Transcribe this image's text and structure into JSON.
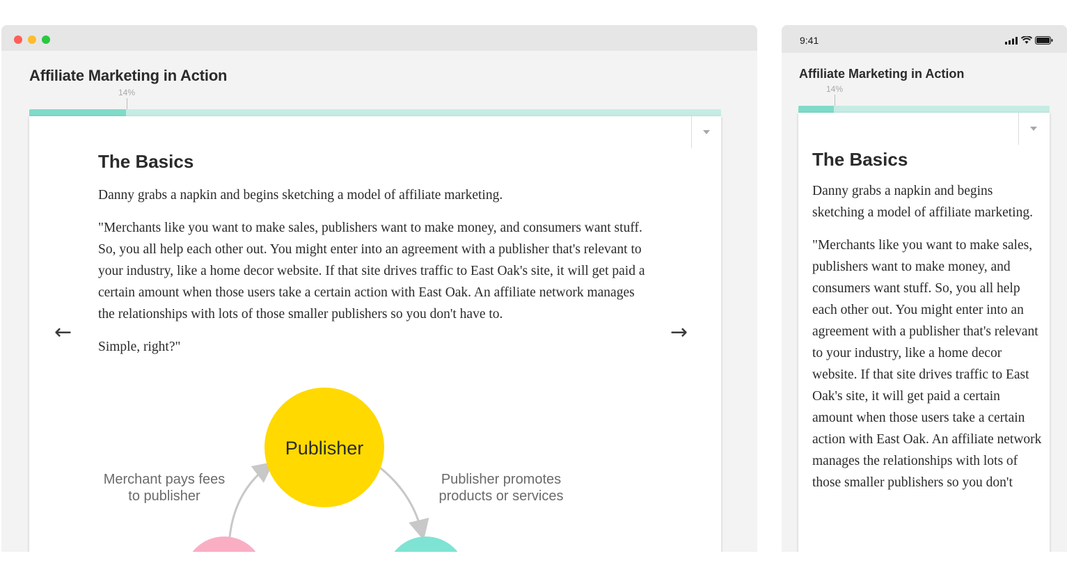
{
  "desktop": {
    "course_title": "Affiliate Marketing in Action",
    "progress": {
      "label": "14%",
      "fraction": 0.14
    },
    "section_heading": "The Basics",
    "paragraphs": [
      "Danny grabs a napkin and begins sketching a model of affiliate marketing.",
      "\"Merchants like you want to make sales, publishers want to make money, and consumers want stuff. So, you all help each other out. You might enter into an agreement with a publisher that's relevant to your industry, like a home decor website. If that site drives traffic to East Oak's site, it will get paid a certain amount when those users take a certain action with East Oak. An affiliate network manages the relationships with lots of those smaller publishers so you don't have to.",
      "Simple, right?\""
    ],
    "nav": {
      "prev_icon": "←",
      "next_icon": "→"
    },
    "diagram": {
      "center_label": "Publisher",
      "left_caption_1": "Merchant pays fees",
      "left_caption_2": "to publisher",
      "right_caption_1": "Publisher promotes",
      "right_caption_2": "products or services",
      "colors": {
        "publisher": "#ffd900",
        "merchant": "#f9aec4",
        "consumer": "#7fe3d4",
        "arrow": "#c8c8c8"
      }
    }
  },
  "mobile": {
    "status_time": "9:41",
    "course_title": "Affiliate Marketing in Action",
    "progress": {
      "label": "14%",
      "fraction": 0.14
    },
    "section_heading": "The Basics",
    "paragraphs": [
      "Danny grabs a napkin and begins sketching a model of affiliate marketing.",
      "\"Merchants like you want to make sales, publishers want to make money, and consumers want stuff. So, you all help each other out. You might enter into an agreement with a publisher that's relevant to your industry, like a home decor website. If that site drives traffic to East Oak's site, it will get paid a certain amount when those users take a certain action with East Oak. An affiliate network manages the relationships with lots of those smaller publishers so you don't"
    ]
  },
  "colors": {
    "progress_fill": "#7fdbc9",
    "progress_track": "#c5ece4",
    "window_chrome": "#e6e6e6",
    "window_bg": "#f3f3f3"
  }
}
